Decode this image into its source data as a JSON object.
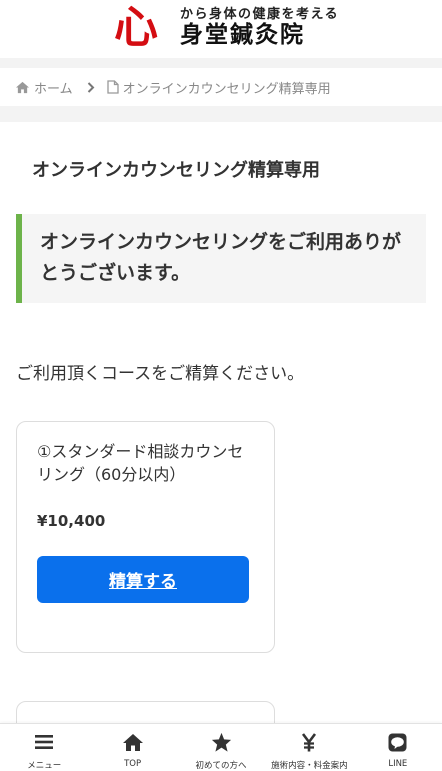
{
  "header": {
    "logo_mark": "心",
    "logo_tagline": "から身体の健康を考える",
    "logo_name": "身堂鍼灸院"
  },
  "breadcrumb": {
    "home": "ホーム",
    "current": "オンラインカウンセリング精算専用"
  },
  "main": {
    "page_title": "オンラインカウンセリング精算専用",
    "notice": "オンラインカウンセリングをご利用ありがとうございます。",
    "intro": "ご利用頂くコースをご精算ください。",
    "courses": [
      {
        "title": "①スタンダード相談カウンセリング（60分以内）",
        "price": "¥10,400",
        "button_label": "精算する"
      }
    ]
  },
  "bottom_nav": [
    {
      "label": "メニュー",
      "icon": "menu-icon"
    },
    {
      "label": "TOP",
      "icon": "home-icon"
    },
    {
      "label": "初めての方へ",
      "icon": "star-icon"
    },
    {
      "label": "施術内容・料金案内",
      "icon": "yen-icon"
    },
    {
      "label": "LINE",
      "icon": "line-icon"
    }
  ],
  "colors": {
    "brand_red": "#d40d12",
    "accent_green": "#6db34a",
    "button_blue": "#0a70ec"
  }
}
